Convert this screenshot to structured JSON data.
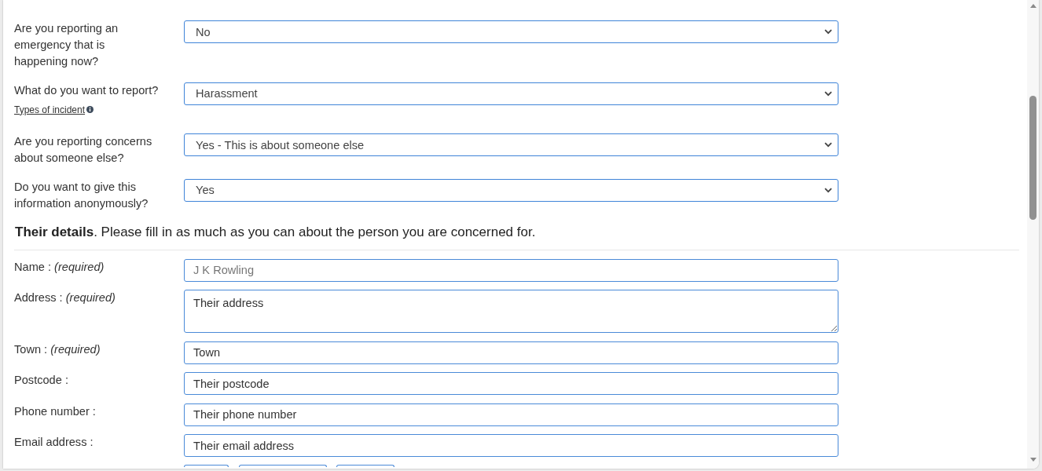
{
  "questions": [
    {
      "label": "Are you reporting an emergency that is happening now?",
      "value": "No"
    },
    {
      "label": "What do you want to report?",
      "value": "Harassment",
      "help_link": "Types of incident"
    },
    {
      "label": "Are you reporting concerns about someone else?",
      "value": "Yes - This is about someone else"
    },
    {
      "label": "Do you want to give this information anonymously?",
      "value": "Yes"
    }
  ],
  "details": {
    "heading": "**Their details**. Please fill in as much as you can about the person you are concerned for.",
    "fields": [
      {
        "kind": "input",
        "label": "Name : *(required)*",
        "placeholder": "J K Rowling"
      },
      {
        "kind": "textarea",
        "label": "Address : *(required)*",
        "value": "Their address"
      },
      {
        "kind": "input",
        "label": "Town : *(required)*",
        "value": "Town"
      },
      {
        "kind": "input",
        "label": "Postcode :",
        "value": "Their postcode"
      },
      {
        "kind": "input",
        "label": "Phone number :",
        "value": "Their phone number"
      },
      {
        "kind": "input",
        "label": "Email address :",
        "value": "Their email address"
      }
    ],
    "cut_off_row": [
      {
        "kind": "input"
      },
      {
        "kind": "input"
      },
      {
        "kind": "input"
      }
    ]
  }
}
